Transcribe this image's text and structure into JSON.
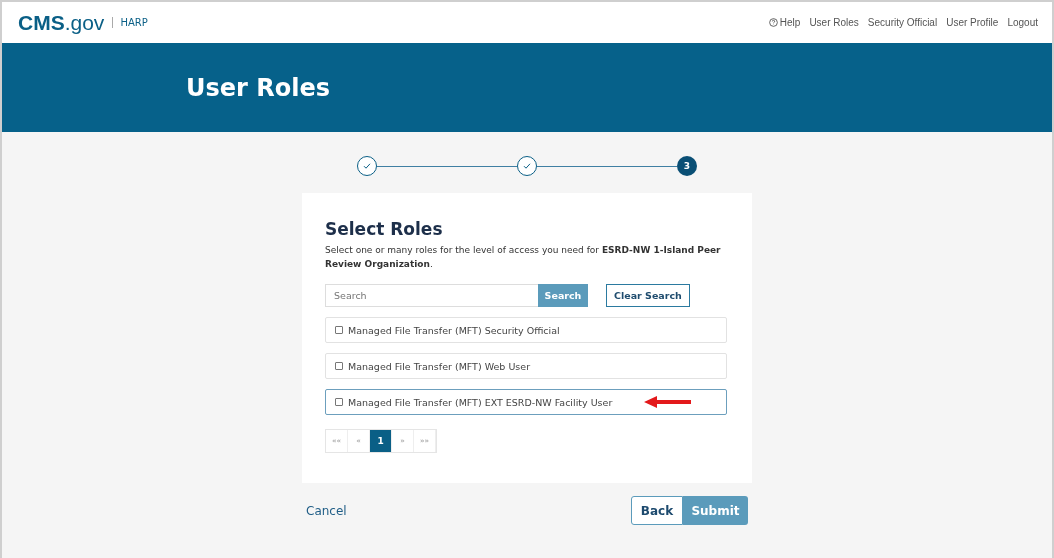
{
  "header": {
    "logo": "CMS",
    "logo_suffix": ".gov",
    "app": "HARP",
    "links": [
      {
        "label": "Help",
        "kind": "help"
      },
      {
        "label": "User Roles",
        "kind": "link"
      },
      {
        "label": "Security Official",
        "kind": "link"
      },
      {
        "label": "User Profile",
        "kind": "link"
      },
      {
        "label": "Logout",
        "kind": "link"
      }
    ]
  },
  "banner": {
    "title": "User Roles"
  },
  "steps": [
    {
      "completed": true
    },
    {
      "completed": true
    },
    {
      "completed": false,
      "label": "3"
    }
  ],
  "card": {
    "title": "Select Roles",
    "description": "Select one or many roles for the level of access you need for **ESRD-NW 1-Island Peer Review Organization**.",
    "search": {
      "placeholder": "Search",
      "button": "Search",
      "clear": "Clear Search"
    },
    "roles": [
      {
        "label": "Managed File Transfer (MFT) Security Official",
        "checked": false,
        "highlighted": false,
        "pointer": false
      },
      {
        "label": "Managed File Transfer (MFT) Web User",
        "checked": false,
        "highlighted": false,
        "pointer": false
      },
      {
        "label": "Managed File Transfer (MFT) EXT ESRD-NW Facility User",
        "checked": false,
        "highlighted": true,
        "pointer": true
      }
    ],
    "pagination": [
      {
        "label": "««",
        "selected": false
      },
      {
        "label": "«",
        "selected": false
      },
      {
        "label": "1",
        "selected": true
      },
      {
        "label": "»",
        "selected": false
      },
      {
        "label": "»»",
        "selected": false
      }
    ]
  },
  "footer": {
    "cancel": "Cancel",
    "back": "Back",
    "submit": {
      "label": "Submit",
      "disabled": true
    }
  }
}
